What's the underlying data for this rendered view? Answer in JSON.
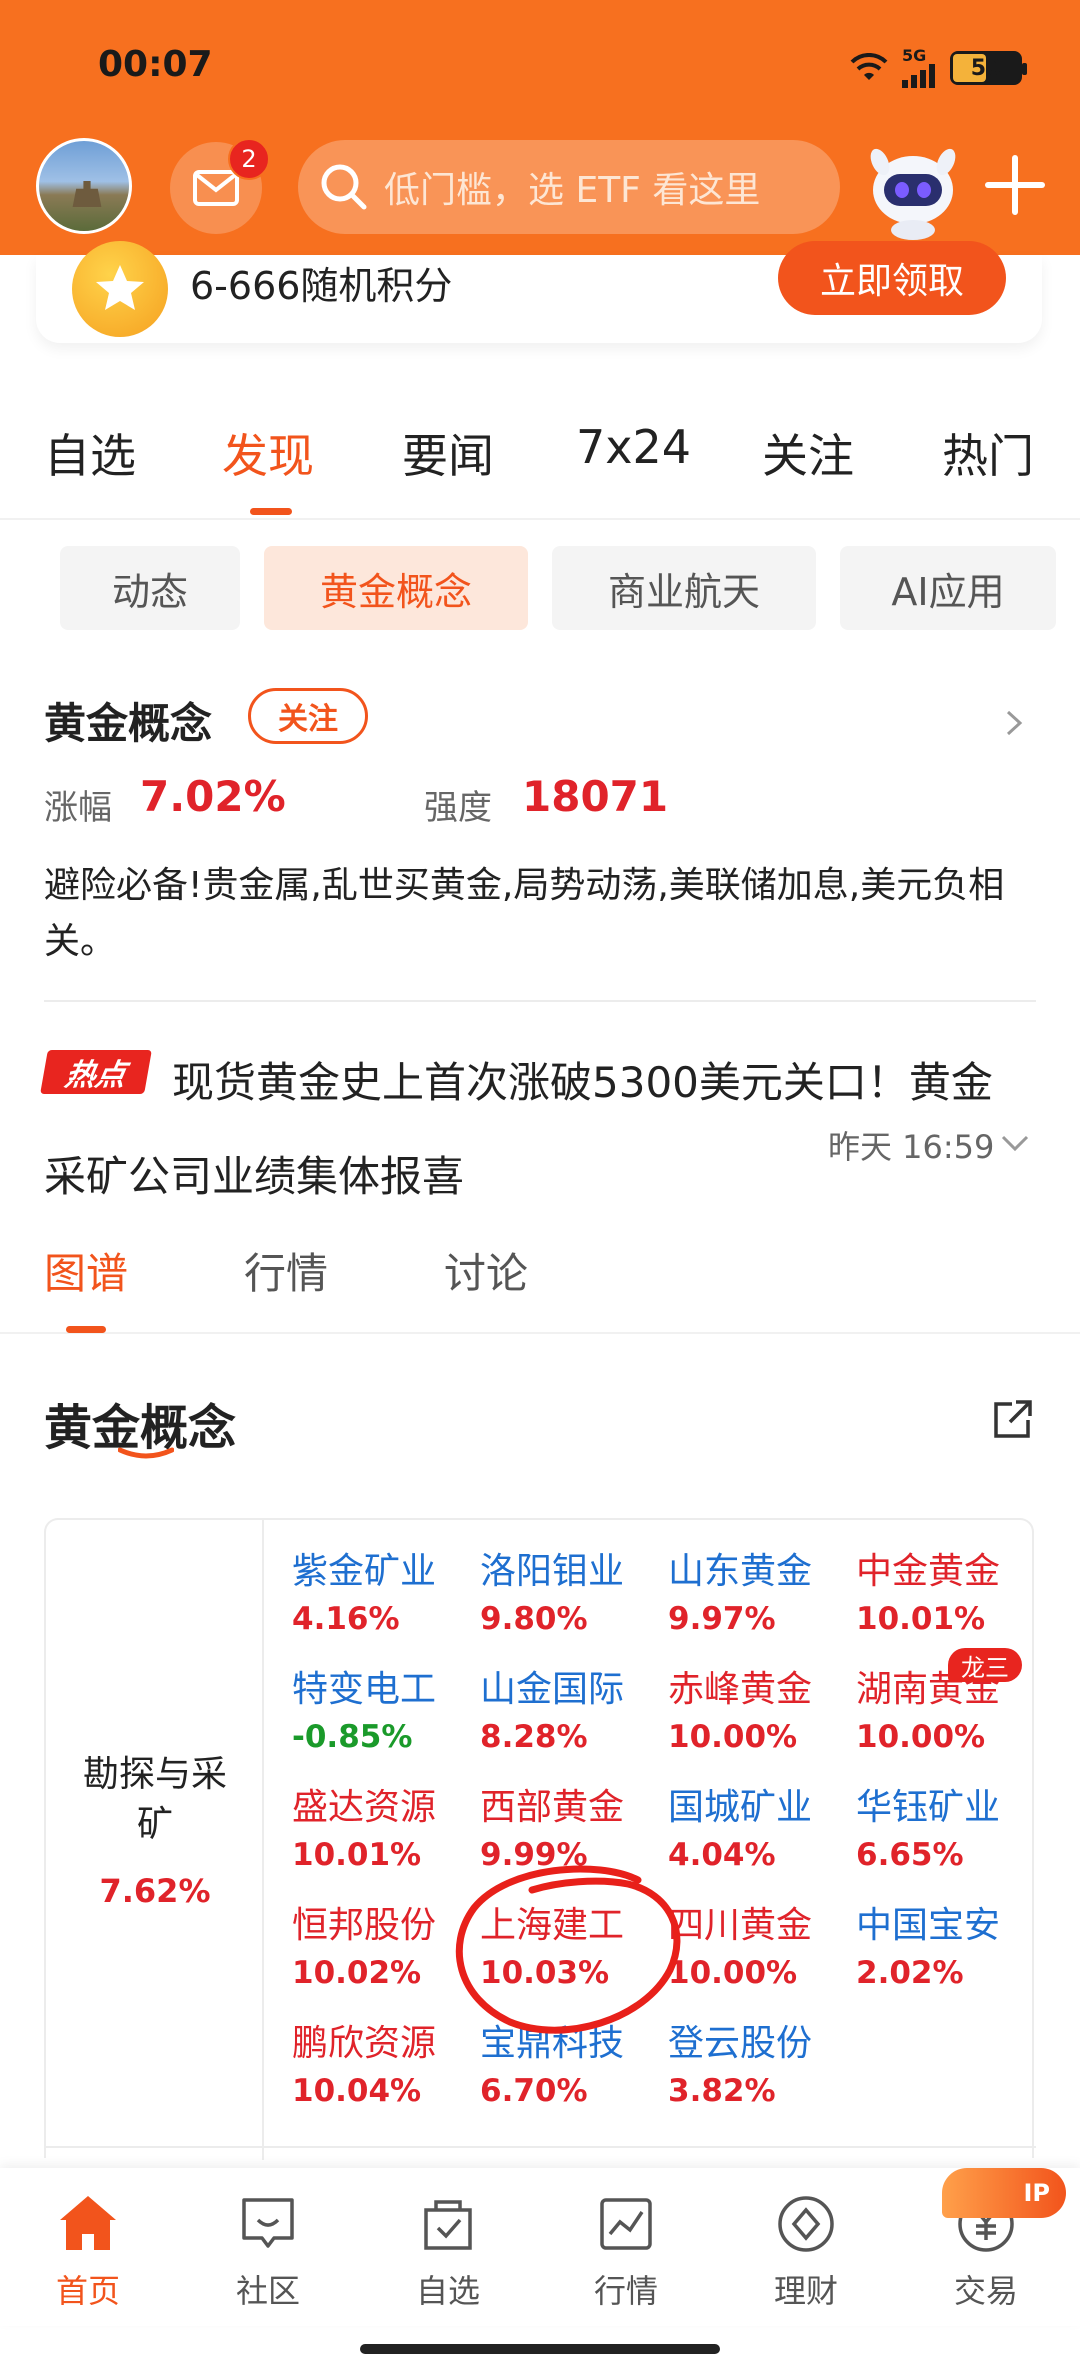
{
  "status_bar": {
    "time": "00:07",
    "network": "5G",
    "battery": "50",
    "battery_fraction": 0.5
  },
  "header": {
    "mail_badge": "2",
    "search_placeholder": "低门槛，选 ETF 看这里"
  },
  "promo": {
    "text": "6-666随机积分",
    "button": "立即领取"
  },
  "main_tabs": [
    "自选",
    "发现",
    "要闻",
    "7x24",
    "关注",
    "热门"
  ],
  "main_tab_active": "发现",
  "sub_tabs": [
    "动态",
    "黄金概念",
    "商业航天",
    "AI应用"
  ],
  "sub_tab_active": "黄金概念",
  "concept": {
    "title": "黄金概念",
    "follow": "关注",
    "rise_label": "涨幅",
    "rise_value": "7.02%",
    "strength_label": "强度",
    "strength_value": "18071",
    "description": "避险必备!贵金属,乱世买黄金,局势动荡,美联储加息,美元负相关。"
  },
  "hot_news": {
    "badge": "热点",
    "text": "现货黄金史上首次涨破5300美元关口！黄金采矿公司业绩集体报喜",
    "time": "昨天 16:59"
  },
  "content_tabs": [
    "图谱",
    "行情",
    "讨论"
  ],
  "content_tab_active": "图谱",
  "section_title": "黄金概念",
  "grid": {
    "category": "勘探与采矿",
    "category_pct": "7.62%",
    "stocks": [
      {
        "name": "紫金矿业",
        "pct": "4.16%",
        "name_color": "blue",
        "pct_color": "red"
      },
      {
        "name": "洛阳钼业",
        "pct": "9.80%",
        "name_color": "blue",
        "pct_color": "red"
      },
      {
        "name": "山东黄金",
        "pct": "9.97%",
        "name_color": "blue",
        "pct_color": "red"
      },
      {
        "name": "中金黄金",
        "pct": "10.01%",
        "name_color": "red",
        "pct_color": "red"
      },
      {
        "name": "特变电工",
        "pct": "-0.85%",
        "name_color": "blue",
        "pct_color": "green"
      },
      {
        "name": "山金国际",
        "pct": "8.28%",
        "name_color": "blue",
        "pct_color": "red"
      },
      {
        "name": "赤峰黄金",
        "pct": "10.00%",
        "name_color": "red",
        "pct_color": "red"
      },
      {
        "name": "湖南黄金",
        "pct": "10.00%",
        "name_color": "red",
        "pct_color": "red"
      },
      {
        "name": "盛达资源",
        "pct": "10.01%",
        "name_color": "red",
        "pct_color": "red"
      },
      {
        "name": "西部黄金",
        "pct": "9.99%",
        "name_color": "red",
        "pct_color": "red"
      },
      {
        "name": "国城矿业",
        "pct": "4.04%",
        "name_color": "blue",
        "pct_color": "red"
      },
      {
        "name": "华钰矿业",
        "pct": "6.65%",
        "name_color": "blue",
        "pct_color": "red"
      },
      {
        "name": "恒邦股份",
        "pct": "10.02%",
        "name_color": "red",
        "pct_color": "red"
      },
      {
        "name": "上海建工",
        "pct": "10.03%",
        "name_color": "red",
        "pct_color": "red"
      },
      {
        "name": "四川黄金",
        "pct": "10.00%",
        "name_color": "red",
        "pct_color": "red"
      },
      {
        "name": "中国宝安",
        "pct": "2.02%",
        "name_color": "blue",
        "pct_color": "red"
      },
      {
        "name": "鹏欣资源",
        "pct": "10.04%",
        "name_color": "red",
        "pct_color": "red"
      },
      {
        "name": "宝鼎科技",
        "pct": "6.70%",
        "name_color": "blue",
        "pct_color": "red"
      },
      {
        "name": "登云股份",
        "pct": "3.82%",
        "name_color": "blue",
        "pct_color": "red"
      }
    ],
    "dragon_badge": "龙三"
  },
  "bottom_nav": [
    "首页",
    "社区",
    "自选",
    "行情",
    "理财",
    "交易"
  ],
  "bottom_nav_active": "首页",
  "nav_pill": "IP",
  "colors": {
    "brand": "#f7701f",
    "accent": "#f2541c",
    "up": "#e0232a",
    "down": "#1a9a2a",
    "link": "#1e6fd0"
  }
}
